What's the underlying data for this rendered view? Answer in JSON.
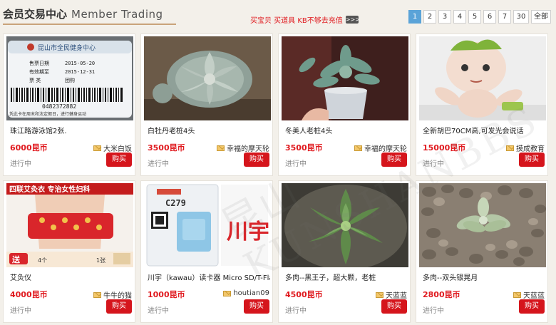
{
  "header": {
    "title_cn": "会员交易中心",
    "title_en": "Member Trading",
    "promo_text": "买宝贝 买道具 KB不够去充值",
    "promo_arrow": ">>>",
    "pages": [
      "1",
      "2",
      "3",
      "4",
      "5",
      "6",
      "7",
      "30",
      "全部"
    ],
    "active_page": "1"
  },
  "items": [
    {
      "name": "珠江路游泳馆2张.",
      "price": "6000昆币",
      "seller": "大米白饭",
      "status": "进行中",
      "buy": "购买",
      "thumb": "membership-card",
      "card_text": {
        "org": "昆山市全民健身中心",
        "buy_date_label": "售票日期",
        "buy_date": "2015-05-20",
        "valid_label": "有效期至",
        "valid_date": "2015-12-31",
        "type_label": "票    类",
        "type_value": "团购",
        "barcode": "0482372882",
        "notice": "凭此卡在周末和法定假日，进行健身运动"
      }
    },
    {
      "name": "白牡丹老桩4头",
      "price": "3500昆币",
      "seller": "幸福的摩天轮",
      "status": "进行中",
      "buy": "购买",
      "thumb": "succulent-white"
    },
    {
      "name": "冬美人老桩4头",
      "price": "3500昆币",
      "seller": "幸福的摩天轮",
      "status": "进行中",
      "buy": "购买",
      "thumb": "succulent-pot"
    },
    {
      "name": "全新胡巴70CM高,可发光会说话",
      "price": "15000昆币",
      "seller": "摸成教育",
      "status": "进行中",
      "buy": "购买",
      "thumb": "plush-toy"
    },
    {
      "name": "艾灸仪",
      "price": "4000昆币",
      "seller": "牛牛的猫",
      "status": "进行中",
      "buy": "购买",
      "thumb": "moxa-belt",
      "banner_text": "四联艾灸衣 专治女性妇科",
      "send_text": "送",
      "qty_a": "4个",
      "qty_b": "1张"
    },
    {
      "name": "川宇（kawau）读卡器 Micro SD/T-Flas",
      "price": "1000昆币",
      "seller": "houtian09",
      "status": "进行中",
      "buy": "购买",
      "thumb": "card-reader",
      "package_text": {
        "model": "C279",
        "brand": "川宇"
      }
    },
    {
      "name": "多肉--黑王子，超大颗，老桩",
      "price": "4500昆币",
      "seller": "天蓝蓝",
      "status": "进行中",
      "buy": "购买",
      "thumb": "succulent-green"
    },
    {
      "name": "多肉--双头银晃月",
      "price": "2800昆币",
      "seller": "天蓝蓝",
      "status": "进行中",
      "buy": "购买",
      "thumb": "succulent-pebbles"
    }
  ],
  "watermark": "昆山 KUNSHANBBS",
  "colors": {
    "accent_red": "#e0191e",
    "buy_button": "#d5151c",
    "pager_active": "#5aa3d8",
    "title_underline": "#c9a37a",
    "background": "#f3f0ea"
  }
}
